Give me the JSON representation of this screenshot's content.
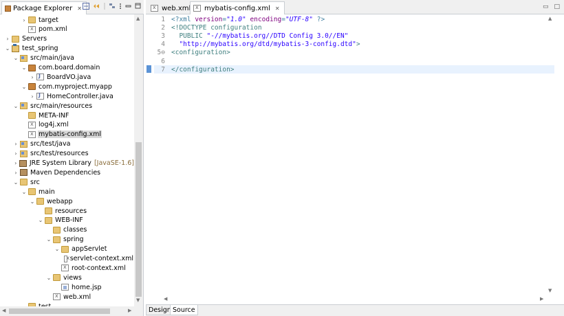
{
  "left_panel": {
    "tab_label": "Package Explorer",
    "tree": [
      {
        "depth": 2,
        "twisty": ">",
        "icon": "folder",
        "label": "target"
      },
      {
        "depth": 2,
        "twisty": "",
        "icon": "xml",
        "label": "pom.xml"
      },
      {
        "depth": 0,
        "twisty": ">",
        "icon": "folder",
        "label": "Servers"
      },
      {
        "depth": 0,
        "twisty": "v",
        "icon": "project",
        "label": "test_spring"
      },
      {
        "depth": 1,
        "twisty": "v",
        "icon": "srcfolder",
        "label": "src/main/java"
      },
      {
        "depth": 2,
        "twisty": "v",
        "icon": "pkg",
        "label": "com.board.domain"
      },
      {
        "depth": 3,
        "twisty": ">",
        "icon": "java",
        "label": "BoardVO.java"
      },
      {
        "depth": 2,
        "twisty": "v",
        "icon": "pkg",
        "label": "com.myproject.myapp"
      },
      {
        "depth": 3,
        "twisty": ">",
        "icon": "java",
        "label": "HomeController.java"
      },
      {
        "depth": 1,
        "twisty": "v",
        "icon": "srcfolder",
        "label": "src/main/resources"
      },
      {
        "depth": 2,
        "twisty": "",
        "icon": "folder",
        "label": "META-INF"
      },
      {
        "depth": 2,
        "twisty": "",
        "icon": "xml",
        "label": "log4j.xml"
      },
      {
        "depth": 2,
        "twisty": "",
        "icon": "xml",
        "label": "mybatis-config.xml",
        "selected": true
      },
      {
        "depth": 1,
        "twisty": ">",
        "icon": "srcfolder",
        "label": "src/test/java"
      },
      {
        "depth": 1,
        "twisty": ">",
        "icon": "srcfolder",
        "label": "src/test/resources"
      },
      {
        "depth": 1,
        "twisty": ">",
        "icon": "lib",
        "label": "JRE System Library",
        "deco": "[JavaSE-1.6]"
      },
      {
        "depth": 1,
        "twisty": ">",
        "icon": "lib",
        "label": "Maven Dependencies"
      },
      {
        "depth": 1,
        "twisty": "v",
        "icon": "folder",
        "label": "src"
      },
      {
        "depth": 2,
        "twisty": "v",
        "icon": "folder",
        "label": "main"
      },
      {
        "depth": 3,
        "twisty": "v",
        "icon": "folder",
        "label": "webapp"
      },
      {
        "depth": 4,
        "twisty": "",
        "icon": "folder",
        "label": "resources"
      },
      {
        "depth": 4,
        "twisty": "v",
        "icon": "folder",
        "label": "WEB-INF"
      },
      {
        "depth": 5,
        "twisty": "",
        "icon": "folder",
        "label": "classes"
      },
      {
        "depth": 5,
        "twisty": "v",
        "icon": "folder",
        "label": "spring"
      },
      {
        "depth": 6,
        "twisty": "v",
        "icon": "folder",
        "label": "appServlet"
      },
      {
        "depth": 7,
        "twisty": "",
        "icon": "xml",
        "label": "servlet-context.xml"
      },
      {
        "depth": 6,
        "twisty": "",
        "icon": "xml",
        "label": "root-context.xml"
      },
      {
        "depth": 5,
        "twisty": "v",
        "icon": "folder",
        "label": "views"
      },
      {
        "depth": 6,
        "twisty": "",
        "icon": "jsp",
        "label": "home.jsp"
      },
      {
        "depth": 5,
        "twisty": "",
        "icon": "xml",
        "label": "web.xml"
      },
      {
        "depth": 2,
        "twisty": "",
        "icon": "folder",
        "label": "test"
      }
    ]
  },
  "editor": {
    "tabs": [
      {
        "label": "web.xml",
        "active": false
      },
      {
        "label": "mybatis-config.xml",
        "active": true
      }
    ],
    "lines": [
      {
        "n": "1",
        "segments": [
          [
            "pi",
            "<?xml "
          ],
          [
            "attr",
            "version"
          ],
          [
            "pi",
            "="
          ],
          [
            "val",
            "\"1.0\""
          ],
          [
            "pi",
            " "
          ],
          [
            "attr",
            "encoding"
          ],
          [
            "pi",
            "="
          ],
          [
            "val",
            "\"UTF-8\""
          ],
          [
            "pi",
            " ?>"
          ]
        ]
      },
      {
        "n": "2",
        "segments": [
          [
            "tag",
            "<!DOCTYPE configuration"
          ]
        ]
      },
      {
        "n": "3",
        "segments": [
          [
            "tag",
            "  PUBLIC "
          ],
          [
            "str",
            "\"-//mybatis.org//DTD Config 3.0//EN\""
          ]
        ]
      },
      {
        "n": "4",
        "segments": [
          [
            "tag",
            "  "
          ],
          [
            "str",
            "\"http://mybatis.org/dtd/mybatis-3-config.dtd\""
          ],
          [
            "tag",
            ">"
          ]
        ]
      },
      {
        "n": "5⊖",
        "segments": [
          [
            "tag",
            "<configuration>"
          ]
        ]
      },
      {
        "n": "6",
        "segments": []
      },
      {
        "n": "7",
        "segments": [
          [
            "tag",
            "</configuration>"
          ]
        ],
        "current": true
      }
    ],
    "bottom_tabs": [
      {
        "label": "Design",
        "active": false
      },
      {
        "label": "Source",
        "active": true
      }
    ]
  }
}
